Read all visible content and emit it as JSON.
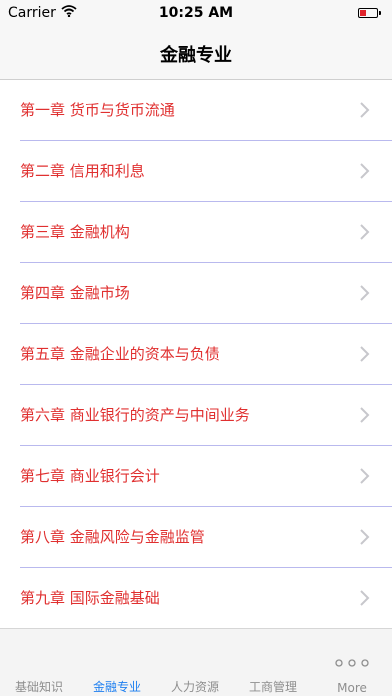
{
  "status_bar": {
    "carrier": "Carrier",
    "time": "10:25 AM"
  },
  "nav": {
    "title": "金融专业"
  },
  "list": {
    "items": [
      "第一章 货币与货币流通",
      "第二章 信用和利息",
      "第三章 金融机构",
      "第四章 金融市场",
      "第五章 金融企业的资本与负债",
      "第六章 商业银行的资产与中间业务",
      "第七章 商业银行会计",
      "第八章 金融风险与金融监管",
      "第九章 国际金融基础"
    ]
  },
  "tabs": [
    {
      "label": "基础知识",
      "active": false
    },
    {
      "label": "金融专业",
      "active": true
    },
    {
      "label": "人力资源",
      "active": false
    },
    {
      "label": "工商管理",
      "active": false
    },
    {
      "label": "More",
      "icon": "more-dots-icon",
      "active": false
    }
  ],
  "colors": {
    "item_text": "#e03030",
    "active_tab": "#1e7ff0",
    "separator": "#b9b9ee"
  }
}
